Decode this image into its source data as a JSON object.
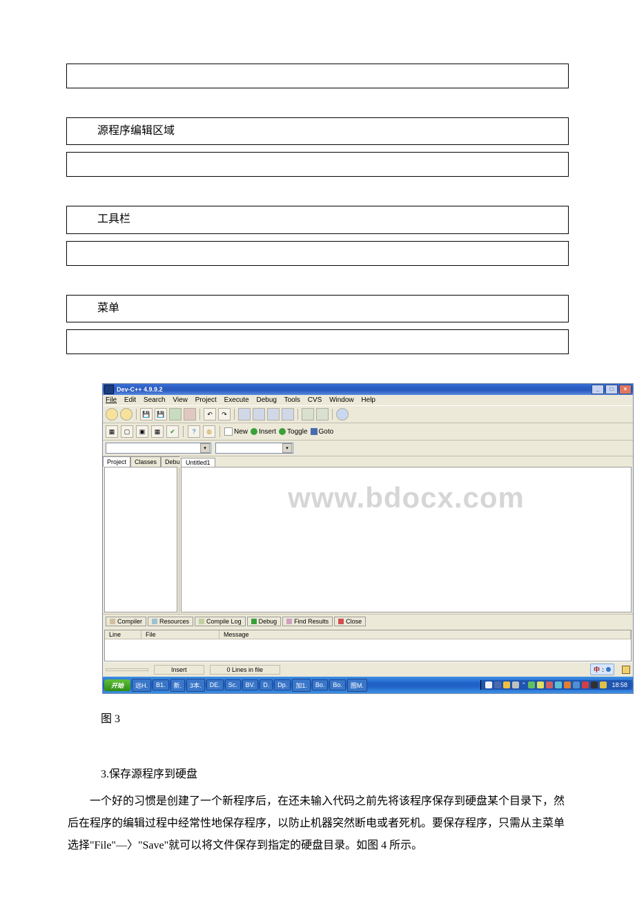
{
  "labels": {
    "box1": "源程序编辑区域",
    "box2": "工具栏",
    "box3": "菜单"
  },
  "screenshot": {
    "title": "Dev-C++ 4.9.9.2",
    "menubar": [
      "File",
      "Edit",
      "Search",
      "View",
      "Project",
      "Execute",
      "Debug",
      "Tools",
      "CVS",
      "Window",
      "Help"
    ],
    "toolbar2": {
      "new": "New",
      "insert": "Insert",
      "toggle": "Toggle",
      "goto": "Goto"
    },
    "left_tabs": [
      "Project",
      "Classes",
      "Debug"
    ],
    "editor_tab": "Untitled1",
    "bottom_tabs": [
      "Compiler",
      "Resources",
      "Compile Log",
      "Debug",
      "Find Results",
      "Close"
    ],
    "msg_cols": {
      "line": "Line",
      "file": "File",
      "message": "Message"
    },
    "status": {
      "insert": "Insert",
      "lines": "0 Lines in file"
    },
    "taskbar": {
      "start": "开始",
      "items": [
        "远H.",
        "B1.",
        "新.",
        "3本.",
        "DE.",
        "Sc.",
        "BV.",
        "D.",
        "Dp.",
        "加1.",
        "Bo.",
        "Bo.",
        "图M."
      ],
      "lang": "中",
      "clock": "18:58"
    },
    "watermark": "www.bdocx.com"
  },
  "caption": "图 3",
  "section": "3.保存源程序到硬盘",
  "paragraph": "一个好的习惯是创建了一个新程序后，在还未输入代码之前先将该程序保存到硬盘某个目录下，然后在程序的编辑过程中经常性地保存程序，以防止机器突然断电或者死机。要保存程序，只需从主菜单选择\"File\"—〉\"Save\"就可以将文件保存到指定的硬盘目录。如图 4 所示。"
}
